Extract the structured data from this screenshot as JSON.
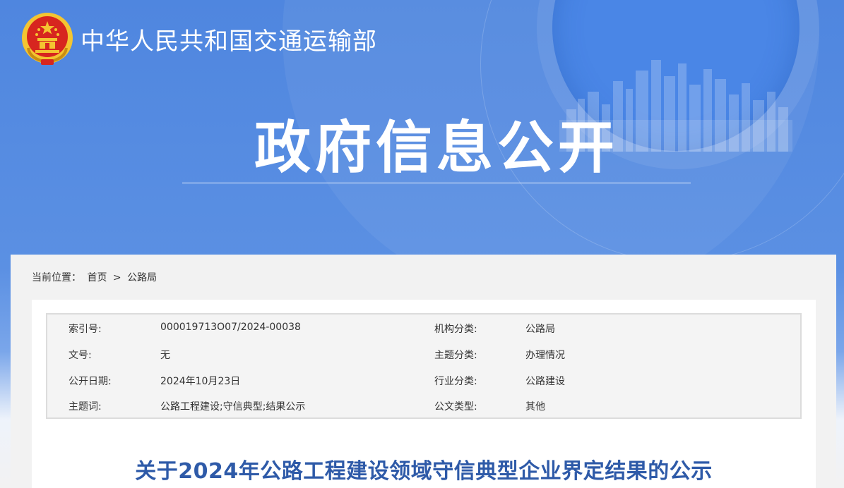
{
  "header": {
    "ministry_name": "中华人民共和国交通运输部",
    "hero_title": "政府信息公开"
  },
  "colors": {
    "banner_blue": "#4f86df",
    "title_blue": "#2e5aa8",
    "emblem_red": "#d7261f",
    "emblem_gold": "#f4c531"
  },
  "icons": {
    "emblem": "national-emblem-icon"
  },
  "breadcrumb": {
    "label": "当前位置：",
    "home": "首页",
    "separator": ">",
    "current": "公路局"
  },
  "meta": {
    "rows": [
      {
        "label1": "索引号:",
        "value1": "000019713O07/2024-00038",
        "label2": "机构分类:",
        "value2": "公路局"
      },
      {
        "label1": "文号:",
        "value1": "无",
        "label2": "主题分类:",
        "value2": "办理情况"
      },
      {
        "label1": "公开日期:",
        "value1": "2024年10月23日",
        "label2": "行业分类:",
        "value2": "公路建设"
      },
      {
        "label1": "主题词:",
        "value1": "公路工程建设;守信典型;结果公示",
        "label2": "公文类型:",
        "value2": "其他"
      }
    ]
  },
  "document": {
    "title": "关于2024年公路工程建设领域守信典型企业界定结果的公示"
  }
}
